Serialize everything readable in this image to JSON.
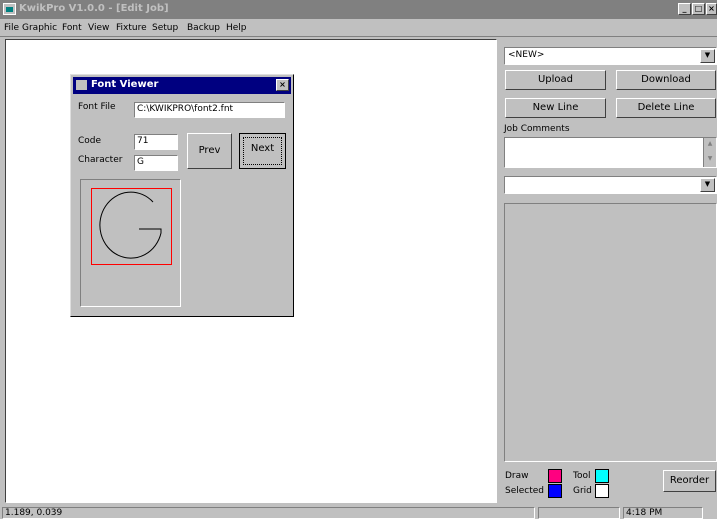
{
  "window": {
    "title": "KwikPro  V1.0.0 - [Edit Job]"
  },
  "menu": [
    "File",
    "Graphic",
    "Font",
    "View",
    "Fixture",
    "Setup",
    "Backup",
    "Help"
  ],
  "font_viewer": {
    "title": "Font Viewer",
    "font_file_label": "Font File",
    "font_file_value": "C:\\KWIKPRO\\font2.fnt",
    "code_label": "Code",
    "code_value": "71",
    "character_label": "Character",
    "character_value": "G",
    "prev_label": "Prev",
    "next_label": "Next",
    "preview_glyph": "G"
  },
  "right_panel": {
    "job_select": "<NEW>",
    "upload": "Upload",
    "download": "Download",
    "new_line": "New Line",
    "delete_line": "Delete Line",
    "job_comments_label": "Job Comments",
    "second_select": "",
    "legend": {
      "draw_label": "Draw",
      "draw_color": "#ff0080",
      "tool_label": "Tool",
      "tool_color": "#00ffff",
      "selected_label": "Selected",
      "selected_color": "#0000ff",
      "grid_label": "Grid",
      "grid_color": "#ffffff"
    },
    "reorder": "Reorder"
  },
  "status": {
    "coords": "1.189, 0.039",
    "time": "4:18 PM"
  }
}
